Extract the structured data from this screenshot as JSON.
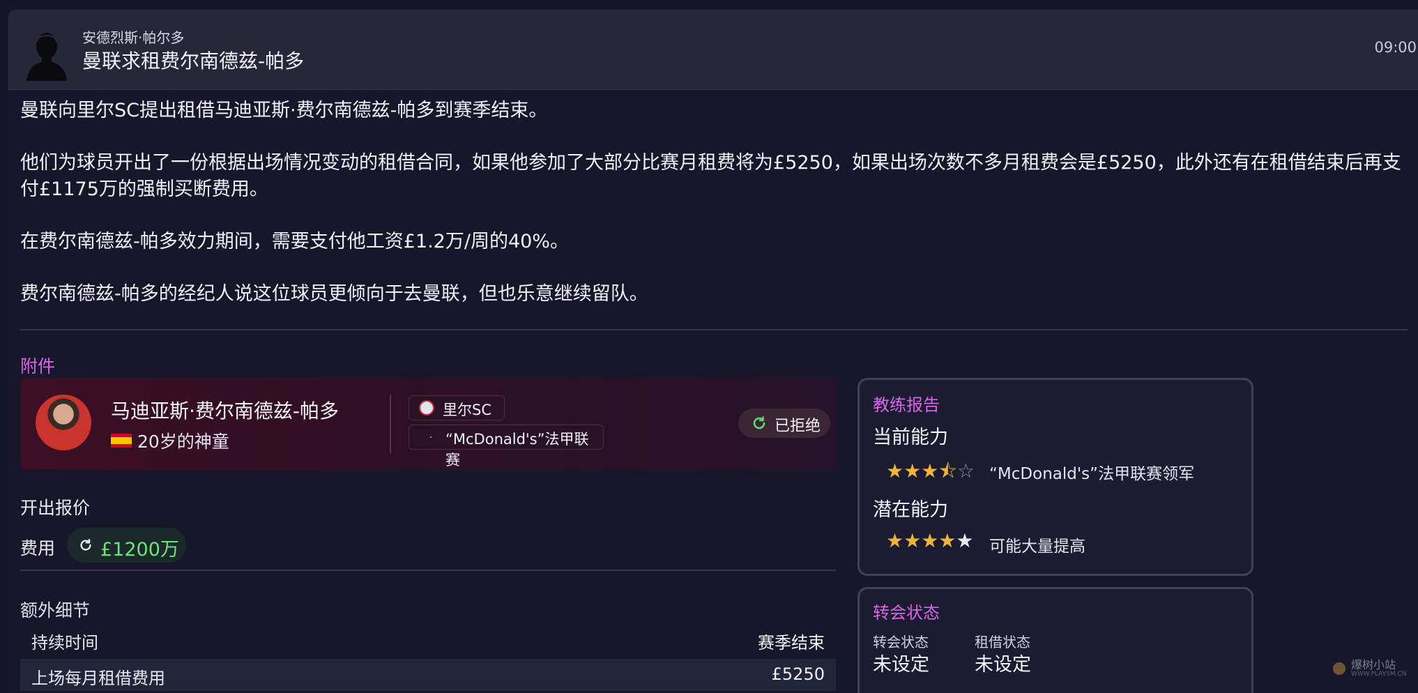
{
  "header": {
    "sender": "安德烈斯·帕尔多",
    "subject": "曼联求租费尔南德兹-帕多",
    "time": "09:00"
  },
  "body": {
    "paragraphs": [
      "曼联向里尔SC提出租借马迪亚斯·费尔南德兹-帕多到赛季结束。",
      "他们为球员开出了一份根据出场情况变动的租借合同，如果他参加了大部分比赛月租费将为£5250，如果出场次数不多月租费会是£5250，此外还有在租借结束后再支付£1175万的强制买断费用。",
      "在费尔南德兹-帕多效力期间，需要支付他工资£1.2万/周的40%。",
      "费尔南德兹-帕多的经纪人说这位球员更倾向于去曼联，但也乐意继续留队。"
    ]
  },
  "attachment": {
    "label": "附件",
    "player": {
      "name": "马迪亚斯·费尔南德兹-帕多",
      "age_desc": "20岁的神童",
      "club": "里尔SC",
      "league": "“McDonald's”法甲联赛",
      "status": "已拒绝"
    }
  },
  "offer": {
    "title": "开出报价",
    "fee_label": "费用",
    "fee_value": "£1200万"
  },
  "extra": {
    "title": "额外细节",
    "rows": [
      {
        "key": "持续时间",
        "value": "赛季结束"
      },
      {
        "key": "上场每月租借费用",
        "value": "£5250"
      }
    ]
  },
  "coach_report": {
    "title": "教练报告",
    "current_label": "当前能力",
    "current_stars": 3.5,
    "current_desc": "“McDonald's”法甲联赛领军",
    "potential_label": "潜在能力",
    "potential_stars": 4.5,
    "potential_desc": "可能大量提高"
  },
  "transfer_status": {
    "title": "转会状态",
    "transfer_label": "转会状态",
    "transfer_value": "未设定",
    "loan_label": "租借状态",
    "loan_value": "未设定"
  },
  "watermark": {
    "text": "爆树小站",
    "sub": "WWW.PLAYSM.CN"
  },
  "colors": {
    "accent": "#dc63e8",
    "fee_green": "#6fe27b",
    "star": "#f0b43c"
  }
}
